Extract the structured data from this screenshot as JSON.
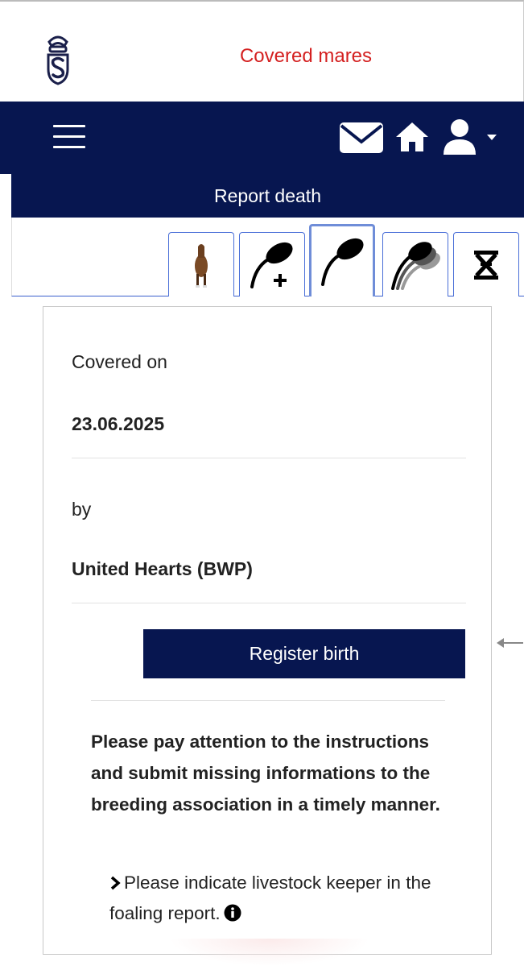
{
  "header": {
    "title": "Covered mares"
  },
  "navbar": {
    "icons": [
      "menu-icon",
      "mail-icon",
      "home-icon",
      "user-icon",
      "caret-down-icon"
    ]
  },
  "subheader": {
    "title": "Report death"
  },
  "tabs": [
    {
      "name": "horse-tab",
      "icon": "horse-icon",
      "active": false
    },
    {
      "name": "add-covering-tab",
      "icon": "sperm-plus-icon",
      "active": false
    },
    {
      "name": "covering-tab",
      "icon": "sperm-icon",
      "active": true
    },
    {
      "name": "coverings-history-tab",
      "icon": "sperm-multiple-icon",
      "active": false
    },
    {
      "name": "dna-tab",
      "icon": "dna-icon",
      "active": false
    }
  ],
  "card": {
    "covered_on_label": "Covered on",
    "covered_on_value": "23.06.2025",
    "by_label": "by",
    "by_value": "United Hearts (BWP)",
    "register_button": "Register birth",
    "notice": "Please pay attention to the instructions and submit missing informations to the breeding association in a timely manner.",
    "instruction": "Please indicate livestock keeper in the foaling report."
  },
  "colors": {
    "navy": "#071650",
    "title_red": "#d42020",
    "tab_border": "#4a6fd8"
  }
}
